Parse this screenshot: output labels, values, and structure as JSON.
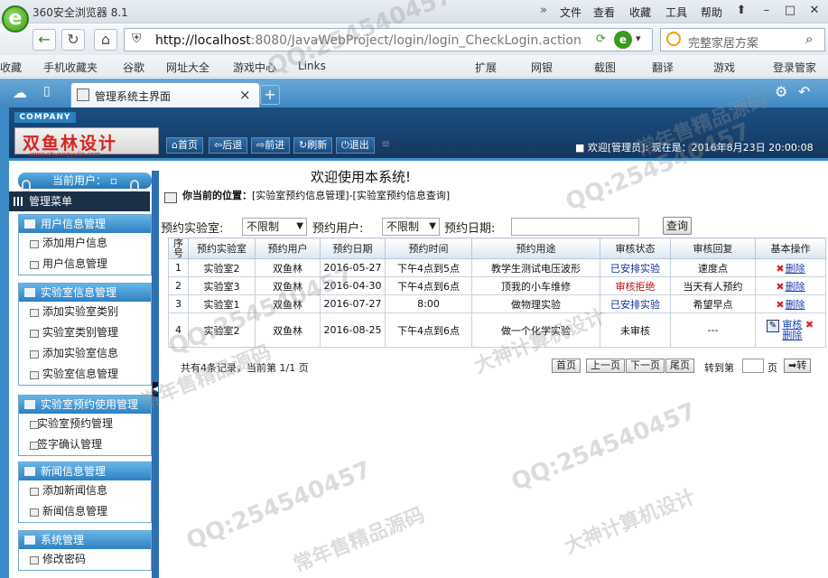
{
  "browser": {
    "name": "360安全浏览器 8.1",
    "logo_letter": "e",
    "menu": [
      "文件",
      "查看",
      "收藏",
      "工具",
      "帮助"
    ],
    "url_host": "http://localhost",
    "url_rest": ":8080/JavaWebProject/login/login_CheckLogin.action",
    "search_text": "完整家居方案",
    "bookmarks": [
      "收藏",
      "手机收藏夹",
      "谷歌",
      "网址大全",
      "游戏中心",
      "Links",
      "扩展",
      "网银",
      "截图",
      "翻译",
      "游戏",
      "登录管家"
    ],
    "tab_title": "管理系统主界面"
  },
  "header": {
    "company": "COMPANY",
    "brand": "双鱼林设计",
    "brand_url": "www.shuangyulin.com",
    "buttons": [
      "首页",
      "后退",
      "前进",
      "刷新",
      "退出"
    ],
    "welcome": "欢迎[管理员]:  现在是：2016年8月23日 20:00:08",
    "welcome_title": "欢迎使用本系统!"
  },
  "sidebar": {
    "current_user": "当前用户：",
    "manager_menu": "管理菜单",
    "groups": [
      {
        "title": "用户信息管理",
        "items": [
          "添加用户信息",
          "用户信息管理"
        ]
      },
      {
        "title": "实验室信息管理",
        "items": [
          "添加实验室类别",
          "实验室类别管理",
          "添加实验室信息",
          "实验室信息管理"
        ]
      },
      {
        "title": "实验室预约使用管理",
        "items": [
          "实验室预约管理",
          "签字确认管理"
        ]
      },
      {
        "title": "新闻信息管理",
        "items": [
          "添加新闻信息",
          "新闻信息管理"
        ]
      },
      {
        "title": "系统管理",
        "items": [
          "修改密码"
        ]
      }
    ]
  },
  "content": {
    "location_label": "你当前的位置：",
    "location_path": "[实验室预约信息管理]-[实验室预约信息查询]",
    "filter_lab_label": "预约实验室:",
    "filter_lab_value": "不限制",
    "filter_user_label": "预约用户:",
    "filter_user_value": "不限制",
    "filter_date_label": "预约日期:",
    "filter_date_value": "",
    "query_button": "查询",
    "columns": [
      "序号",
      "预约实验室",
      "预约用户",
      "预约日期",
      "预约时间",
      "预约用途",
      "审核状态",
      "审核回复",
      "基本操作"
    ],
    "rows": [
      [
        "1",
        "实验室2",
        "双鱼林",
        "2016-05-27",
        "下午4点到5点",
        "教学生测试电压波形",
        "已安排实验",
        "速度点",
        "删除"
      ],
      [
        "2",
        "实验室3",
        "双鱼林",
        "2016-04-30",
        "下午4点到6点",
        "顶我的小车维修",
        "审核拒绝",
        "当天有人预约",
        "删除"
      ],
      [
        "3",
        "实验室1",
        "双鱼林",
        "2016-07-27",
        "8:00",
        "做物理实验",
        "已安排实验",
        "希望早点",
        "删除"
      ],
      [
        "4",
        "实验室2",
        "双鱼林",
        "2016-08-25",
        "下午4点到6点",
        "做一个化学实验",
        "未审核",
        "---",
        "删除"
      ]
    ],
    "row4_review": "审核",
    "pager_info": "共有4条记录，当前第 1/1 页",
    "pager_buttons": [
      "首页",
      "上一页",
      "下一页",
      "尾页"
    ],
    "goto_label": "转到第",
    "goto_unit": "页",
    "goto_button": "转"
  },
  "watermarks": [
    "QQ:254540457",
    "常年售精品源码",
    "大神计算机设计"
  ],
  "colors": {
    "accent": "#2a7fc0",
    "header_bg": "#15365c",
    "refused": "#c01010",
    "arranged": "#1030a0"
  }
}
